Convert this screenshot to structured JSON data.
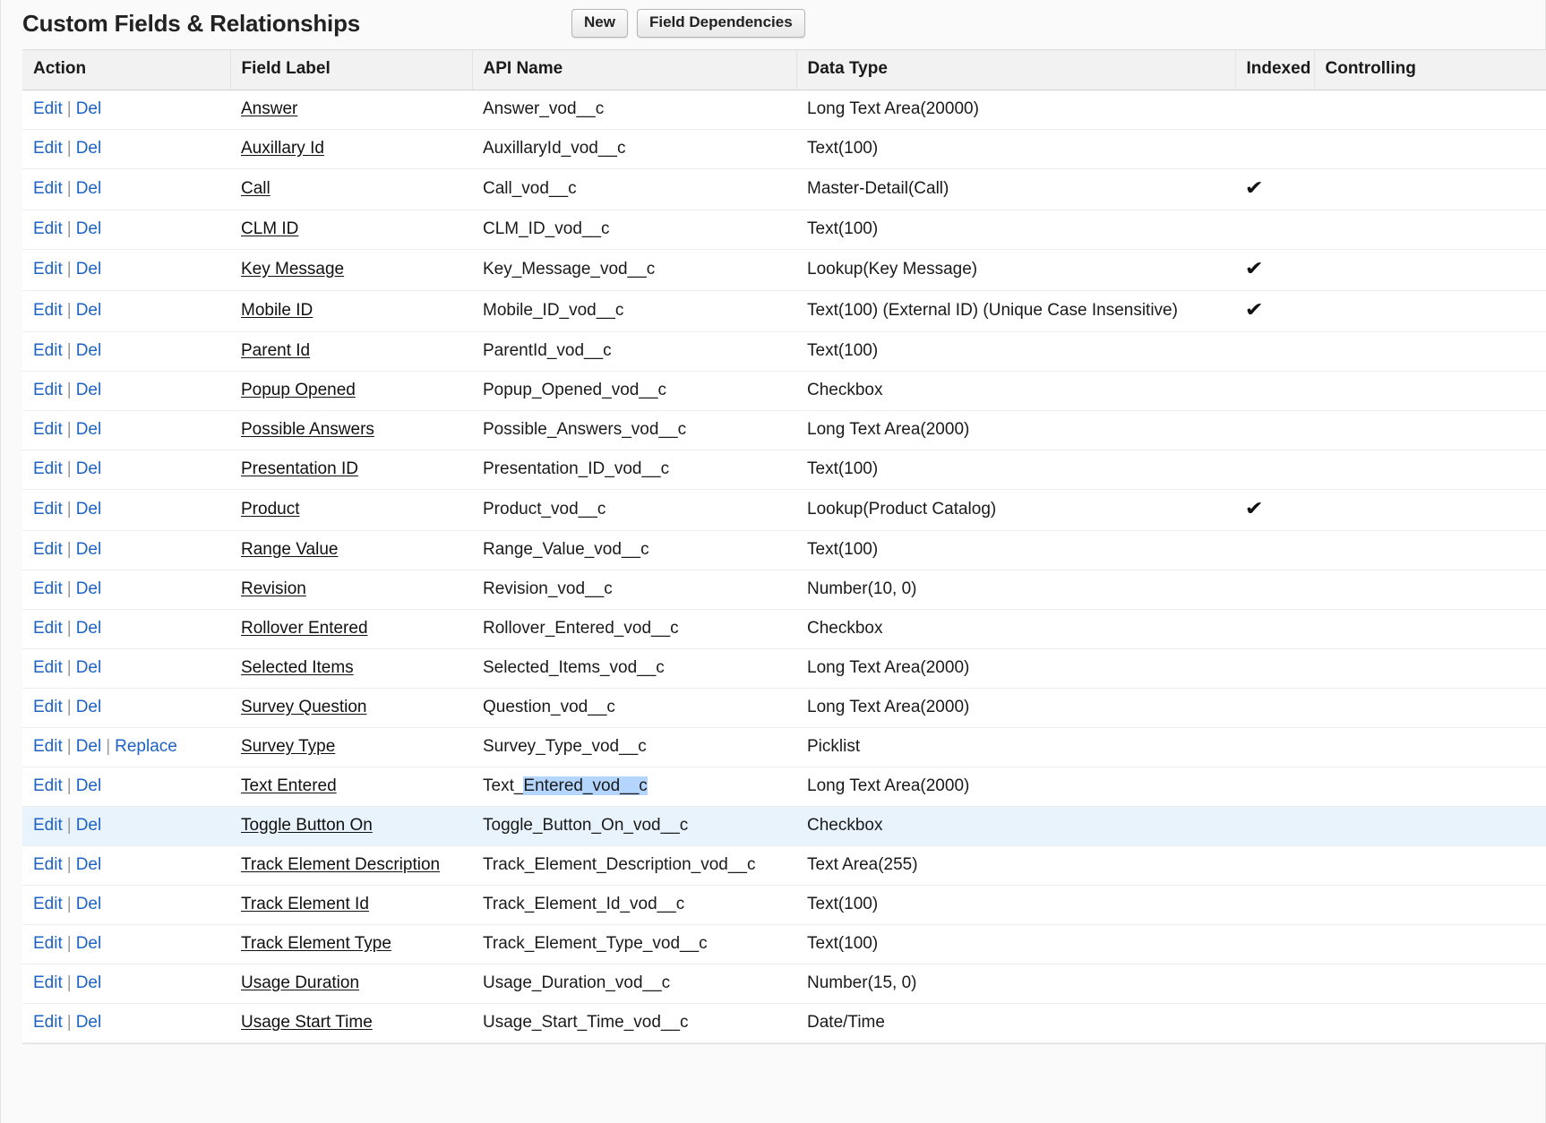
{
  "header": {
    "title": "Custom Fields & Relationships",
    "buttons": [
      {
        "label": "New",
        "name": "new-button"
      },
      {
        "label": "Field Dependencies",
        "name": "field-dependencies-button"
      }
    ]
  },
  "table": {
    "columns": [
      "Action",
      "Field Label",
      "API Name",
      "Data Type",
      "Indexed",
      "Controlling"
    ],
    "actions": {
      "edit": "Edit",
      "del": "Del",
      "replace": "Replace",
      "separator": "|"
    },
    "indexed_mark": "✔",
    "rows": [
      {
        "label": "Answer",
        "api_name": "Answer_vod__c",
        "data_type": "Long Text Area(20000)",
        "indexed": false,
        "has_replace": false,
        "highlighted": false
      },
      {
        "label": "Auxillary Id",
        "api_name": "AuxillaryId_vod__c",
        "data_type": "Text(100)",
        "indexed": false,
        "has_replace": false,
        "highlighted": false
      },
      {
        "label": "Call",
        "api_name": "Call_vod__c",
        "data_type": "Master-Detail(Call)",
        "indexed": true,
        "has_replace": false,
        "highlighted": false
      },
      {
        "label": "CLM ID",
        "api_name": "CLM_ID_vod__c",
        "data_type": "Text(100)",
        "indexed": false,
        "has_replace": false,
        "highlighted": false
      },
      {
        "label": "Key Message",
        "api_name": "Key_Message_vod__c",
        "data_type": "Lookup(Key Message)",
        "indexed": true,
        "has_replace": false,
        "highlighted": false
      },
      {
        "label": "Mobile ID",
        "api_name": "Mobile_ID_vod__c",
        "data_type": "Text(100) (External ID) (Unique Case Insensitive)",
        "indexed": true,
        "has_replace": false,
        "highlighted": false
      },
      {
        "label": "Parent Id",
        "api_name": "ParentId_vod__c",
        "data_type": "Text(100)",
        "indexed": false,
        "has_replace": false,
        "highlighted": false
      },
      {
        "label": "Popup Opened",
        "api_name": "Popup_Opened_vod__c",
        "data_type": "Checkbox",
        "indexed": false,
        "has_replace": false,
        "highlighted": false
      },
      {
        "label": "Possible Answers",
        "api_name": "Possible_Answers_vod__c",
        "data_type": "Long Text Area(2000)",
        "indexed": false,
        "has_replace": false,
        "highlighted": false
      },
      {
        "label": "Presentation ID",
        "api_name": "Presentation_ID_vod__c",
        "data_type": "Text(100)",
        "indexed": false,
        "has_replace": false,
        "highlighted": false
      },
      {
        "label": "Product",
        "api_name": "Product_vod__c",
        "data_type": "Lookup(Product Catalog)",
        "indexed": true,
        "has_replace": false,
        "highlighted": false
      },
      {
        "label": "Range Value",
        "api_name": "Range_Value_vod__c",
        "data_type": "Text(100)",
        "indexed": false,
        "has_replace": false,
        "highlighted": false
      },
      {
        "label": "Revision",
        "api_name": "Revision_vod__c",
        "data_type": "Number(10, 0)",
        "indexed": false,
        "has_replace": false,
        "highlighted": false
      },
      {
        "label": "Rollover Entered",
        "api_name": "Rollover_Entered_vod__c",
        "data_type": "Checkbox",
        "indexed": false,
        "has_replace": false,
        "highlighted": false
      },
      {
        "label": "Selected Items",
        "api_name": "Selected_Items_vod__c",
        "data_type": "Long Text Area(2000)",
        "indexed": false,
        "has_replace": false,
        "highlighted": false
      },
      {
        "label": "Survey Question",
        "api_name": "Question_vod__c",
        "data_type": "Long Text Area(2000)",
        "indexed": false,
        "has_replace": false,
        "highlighted": false
      },
      {
        "label": "Survey Type",
        "api_name": "Survey_Type_vod__c",
        "data_type": "Picklist",
        "indexed": false,
        "has_replace": true,
        "highlighted": false
      },
      {
        "label": "Text Entered",
        "api_name": "Text_Entered_vod__c",
        "api_name_prefix": "Text_",
        "api_name_selected": "Entered_vod__c",
        "data_type": "Long Text Area(2000)",
        "indexed": false,
        "has_replace": false,
        "highlighted": false,
        "selection": true
      },
      {
        "label": "Toggle Button On",
        "api_name": "Toggle_Button_On_vod__c",
        "data_type": "Checkbox",
        "indexed": false,
        "has_replace": false,
        "highlighted": true
      },
      {
        "label": "Track Element Description",
        "api_name": "Track_Element_Description_vod__c",
        "data_type": "Text Area(255)",
        "indexed": false,
        "has_replace": false,
        "highlighted": false
      },
      {
        "label": "Track Element Id",
        "api_name": "Track_Element_Id_vod__c",
        "data_type": "Text(100)",
        "indexed": false,
        "has_replace": false,
        "highlighted": false
      },
      {
        "label": "Track Element Type",
        "api_name": "Track_Element_Type_vod__c",
        "data_type": "Text(100)",
        "indexed": false,
        "has_replace": false,
        "highlighted": false
      },
      {
        "label": "Usage Duration",
        "api_name": "Usage_Duration_vod__c",
        "data_type": "Number(15, 0)",
        "indexed": false,
        "has_replace": false,
        "highlighted": false
      },
      {
        "label": "Usage Start Time",
        "api_name": "Usage_Start_Time_vod__c",
        "data_type": "Date/Time",
        "indexed": false,
        "has_replace": false,
        "highlighted": false
      }
    ]
  },
  "colors": {
    "link": "#1d62c4",
    "header_bg": "#f2f2f2",
    "row_highlight": "#e8f3fc",
    "text_selection": "#b4d5fe"
  }
}
